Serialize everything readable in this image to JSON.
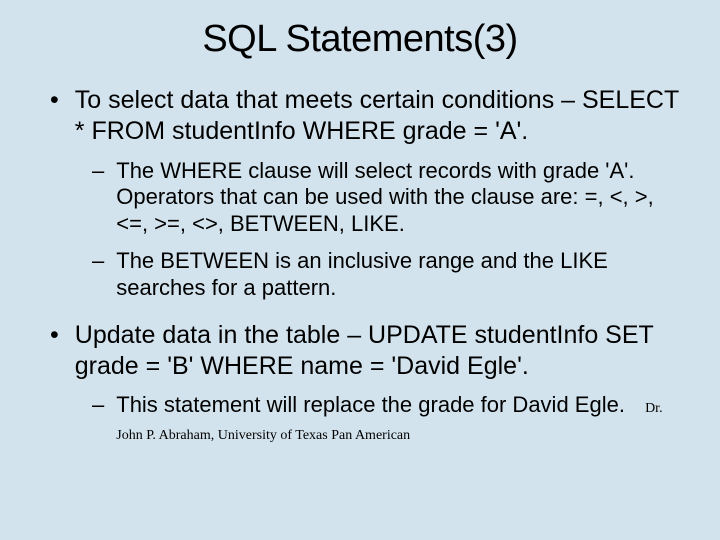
{
  "title": "SQL Statements(3)",
  "items": [
    {
      "level": 1,
      "text": "To select data that meets certain conditions – SELECT * FROM studentInfo WHERE grade = 'A'."
    },
    {
      "level": 2,
      "text": "The WHERE clause will select records with grade 'A'. Operators that can be used with the clause are: =, <, >, <=, >=, <>, BETWEEN, LIKE."
    },
    {
      "level": 2,
      "text": "The BETWEEN is an inclusive range and the LIKE searches for a pattern."
    },
    {
      "level": 1,
      "text": "Update data in the table – UPDATE studentInfo SET grade = 'B' WHERE name = 'David Egle'."
    },
    {
      "level": 2,
      "text": "This statement will replace the grade for David Egle."
    }
  ],
  "footer": "Dr. John P. Abraham, University of Texas Pan American"
}
